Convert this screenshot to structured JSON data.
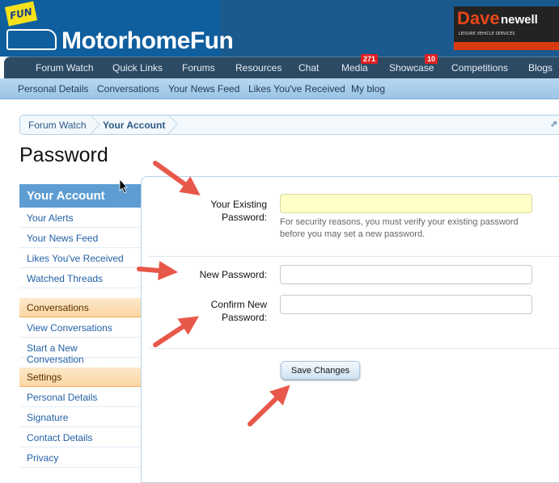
{
  "header": {
    "logo_badge": "FUN",
    "logo_text": "MotorhomeFun",
    "ad": {
      "brand_a": "Dave",
      "brand_b": "newell",
      "tagline": "LEISURE VEHICLE SERVICES"
    }
  },
  "nav": {
    "items": [
      {
        "label": "Forum Watch"
      },
      {
        "label": "Quick Links"
      },
      {
        "label": "Forums"
      },
      {
        "label": "Resources"
      },
      {
        "label": "Chat"
      },
      {
        "label": "Media",
        "badge": "271"
      },
      {
        "label": "Showcase",
        "badge": "10"
      },
      {
        "label": "Competitions"
      },
      {
        "label": "Blogs"
      }
    ]
  },
  "subnav": {
    "items": [
      "Personal Details",
      "Conversations",
      "Your News Feed",
      "Likes You've Received",
      "My blog"
    ]
  },
  "breadcrumb": [
    "Forum Watch",
    "Your Account"
  ],
  "page_title": "Password",
  "sidebar": {
    "title": "Your Account",
    "items1": [
      "Your Alerts",
      "Your News Feed",
      "Likes You've Received",
      "Watched Threads"
    ],
    "group2": "Conversations",
    "items2": [
      "View Conversations",
      "Start a New Conversation"
    ],
    "group3": "Settings",
    "items3": [
      "Personal Details",
      "Signature",
      "Contact Details",
      "Privacy"
    ]
  },
  "form": {
    "existing_label": "Your Existing Password:",
    "existing_value": "",
    "help": "For security reasons, you must verify your existing password before you may set a new password.",
    "new_label": "New Password:",
    "new_value": "",
    "confirm_label": "Confirm New Password:",
    "confirm_value": "",
    "save_label": "Save Changes"
  },
  "colors": {
    "accent": "#5d9dd3",
    "nav": "#2c4a64",
    "annotation_arrow": "#e8584a",
    "badge": "#e02020"
  }
}
